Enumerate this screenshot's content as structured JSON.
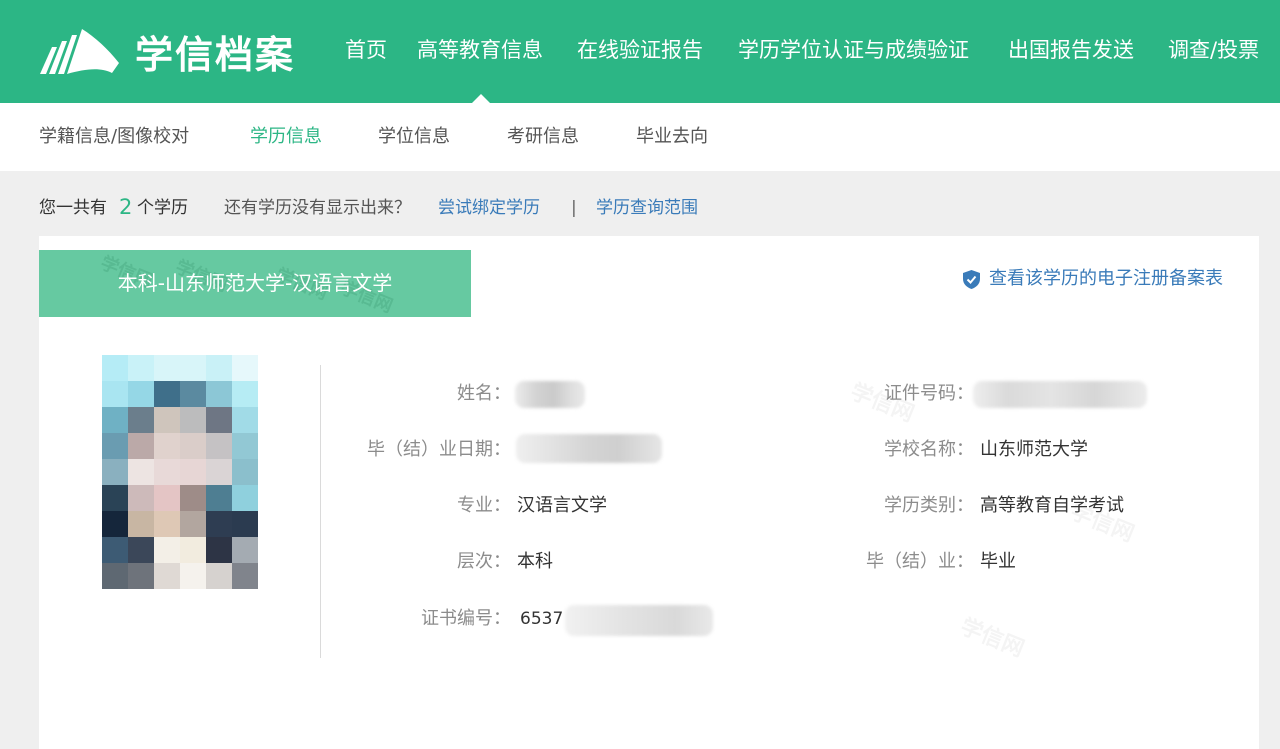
{
  "colors": {
    "brand": "#2cb685",
    "tab": "#66c9a1",
    "link": "#3a7bb9",
    "page_bg": "#efefef",
    "label": "#8c8c8c",
    "value": "#333333"
  },
  "header": {
    "logo_icon": "book-pages-logo-icon",
    "logo_text": "学信档案",
    "nav": [
      {
        "label": "首页",
        "active": false
      },
      {
        "label": "高等教育信息",
        "active": true
      },
      {
        "label": "在线验证报告",
        "active": false
      },
      {
        "label": "学历学位认证与成绩验证",
        "active": false
      },
      {
        "label": "出国报告发送",
        "active": false
      },
      {
        "label": "调查/投票",
        "active": false
      }
    ]
  },
  "subnav": {
    "items": [
      {
        "label": "学籍信息/图像校对",
        "active": false
      },
      {
        "label": "学历信息",
        "active": true
      },
      {
        "label": "学位信息",
        "active": false
      },
      {
        "label": "考研信息",
        "active": false
      },
      {
        "label": "毕业去向",
        "active": false
      }
    ]
  },
  "summary": {
    "prefix": "您一共有",
    "count": 2,
    "suffix": "个学历",
    "question": "还有学历没有显示出来？",
    "bind_link": "尝试绑定学历",
    "separator": "|",
    "scope_link": "学历查询范围"
  },
  "record": {
    "tab_label": "本科-山东师范大学-汉语言文学",
    "registration_link": {
      "icon": "shield-check-icon",
      "label": "查看该学历的电子注册备案表"
    },
    "photo": {
      "redacted": true,
      "pixels": [
        [
          "#b5ecf6",
          "#c9f2f8",
          "#d8f5f9",
          "#d8f5f9",
          "#c9f1f7",
          "#e6f8fb"
        ],
        [
          "#a9e5f1",
          "#95d7e6",
          "#3f6f8a",
          "#5b8aa0",
          "#8cc7d6",
          "#b6ecf4"
        ],
        [
          "#6fb1c4",
          "#6b7e8c",
          "#cfc5bc",
          "#bcbcbd",
          "#6e7684",
          "#a1dbe7"
        ],
        [
          "#6a9cb1",
          "#bba9a8",
          "#e0d2cd",
          "#dacdc9",
          "#c5c2c4",
          "#92c8d4"
        ],
        [
          "#8ab0bf",
          "#ede4e2",
          "#e8d9d8",
          "#e7d6d5",
          "#dad4d5",
          "#8bbfcc"
        ],
        [
          "#2a4356",
          "#cdbaba",
          "#e4c5c5",
          "#9e8c88",
          "#4e7e92",
          "#8fd0dd"
        ],
        [
          "#15263b",
          "#c8b6a3",
          "#dec8b5",
          "#b2a69f",
          "#2e3d52",
          "#2b3b50"
        ],
        [
          "#3d5b74",
          "#3b4759",
          "#f3efe7",
          "#f2ecdf",
          "#2d3445",
          "#a4abb2"
        ],
        [
          "#5e6872",
          "#6e737b",
          "#dfd9d4",
          "#f5f2ed",
          "#d6d2cf",
          "#80848c"
        ]
      ]
    },
    "fields_left": [
      {
        "label": "姓名：",
        "redacted": true
      },
      {
        "label": "毕（结）业日期：",
        "redacted": true
      },
      {
        "label": "专业：",
        "value": "汉语言文学"
      },
      {
        "label": "层次：",
        "value": "本科"
      },
      {
        "label": "证书编号：",
        "value": "6537",
        "redacted_suffix": true
      }
    ],
    "fields_right": [
      {
        "label": "证件号码：",
        "redacted": true
      },
      {
        "label": "学校名称：",
        "value": "山东师范大学"
      },
      {
        "label": "学历类别：",
        "value": "高等教育自学考试"
      },
      {
        "label": "毕（结）业：",
        "value": "毕业"
      }
    ]
  },
  "watermark": "学信网"
}
